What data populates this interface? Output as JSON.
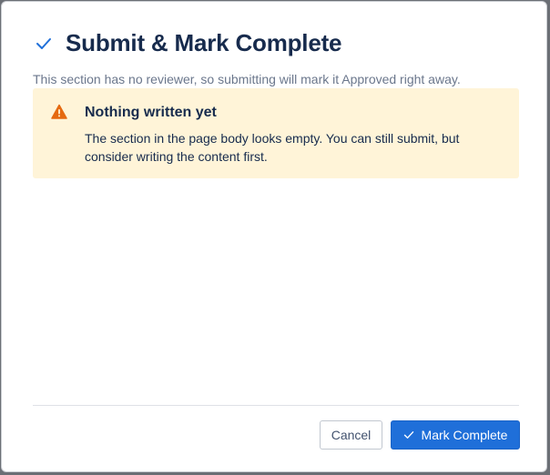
{
  "dialog": {
    "title": "Submit & Mark Complete",
    "title_icon": "check-icon",
    "subtitle": "This section has no reviewer, so submitting will mark it Approved right away.",
    "warning": {
      "icon": "warning-triangle-icon",
      "title": "Nothing written yet",
      "body": "The section in the page body looks empty. You can still submit, but consider writing the content first."
    },
    "actions": {
      "cancel_label": "Cancel",
      "confirm_label": "Mark Complete",
      "confirm_icon": "check-icon"
    }
  },
  "colors": {
    "title": "#172b4d",
    "accent": "#1f6fd9",
    "warning_bg": "#fff4d8",
    "warning_icon": "#e56910",
    "subtle_text": "#6b778c"
  }
}
